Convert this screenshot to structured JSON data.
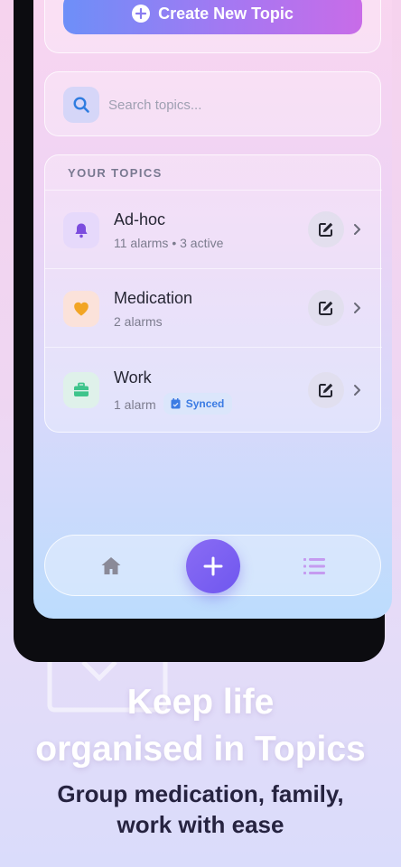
{
  "create_button": {
    "label": "Create New Topic"
  },
  "search": {
    "placeholder": "Search topics..."
  },
  "topics": {
    "section_label": "YOUR TOPICS",
    "items": [
      {
        "title": "Ad-hoc",
        "subtitle": "11 alarms • 3 active",
        "icon": "bell-icon",
        "icon_color": "#7c4dde",
        "icon_bg": "#e6d9fb"
      },
      {
        "title": "Medication",
        "subtitle": "2 alarms",
        "icon": "heart-icon",
        "icon_color": "#f2a524",
        "icon_bg": "#fbe2da"
      },
      {
        "title": "Work",
        "subtitle": "1 alarm",
        "badge": "Synced",
        "icon": "briefcase-icon",
        "icon_color": "#3ec48b",
        "icon_bg": "#dff1ea"
      }
    ]
  },
  "bottom_nav": {
    "items": [
      "home-icon",
      "plus-icon",
      "list-icon"
    ]
  },
  "marketing": {
    "headline_line1": "Keep life",
    "headline_line2": "organised in Topics",
    "subline_line1": "Group medication, family,",
    "subline_line2": "work with ease"
  },
  "colors": {
    "accent": "#6f57ef",
    "badge_text": "#3b7be3"
  }
}
